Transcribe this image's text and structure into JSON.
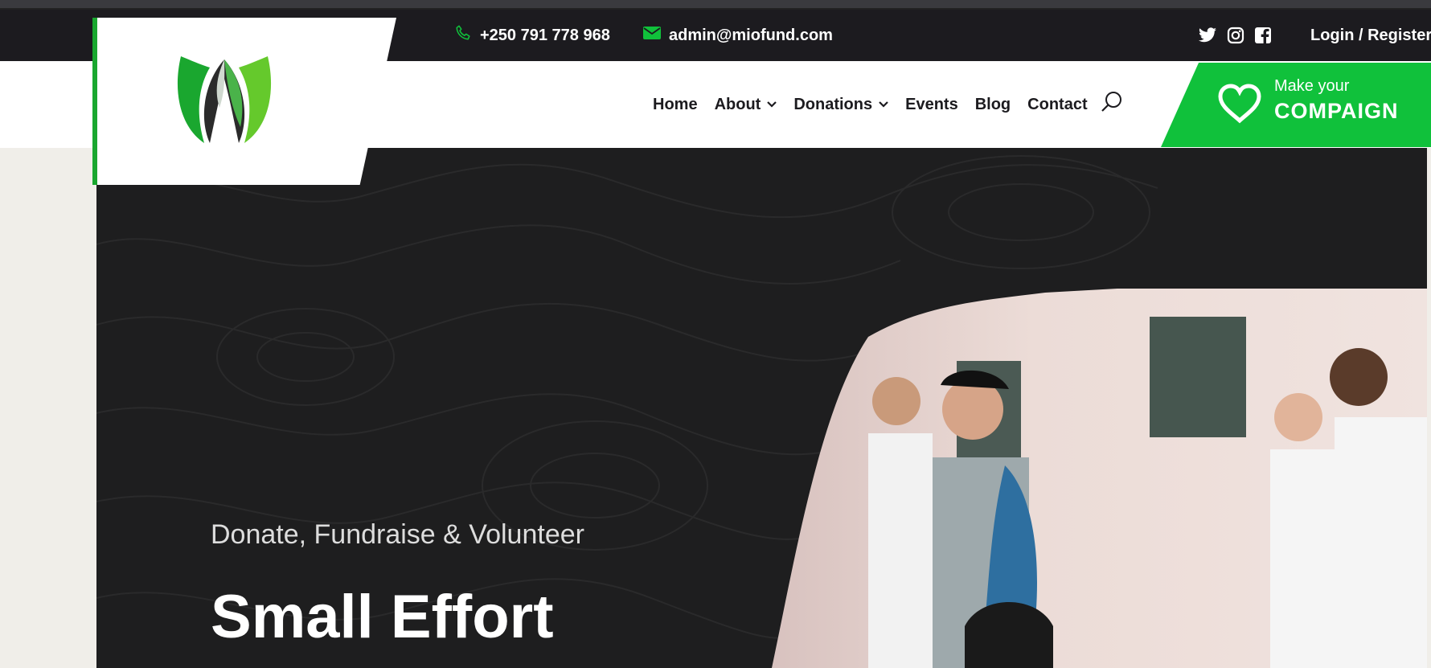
{
  "topbar": {
    "phone": "+250 791 778 968",
    "email": "admin@miofund.com",
    "social": [
      "twitter-icon",
      "instagram-icon",
      "facebook-icon"
    ],
    "login_label": "Login / Register"
  },
  "nav": {
    "items": [
      {
        "label": "Home"
      },
      {
        "label": "About"
      },
      {
        "label": "Donations"
      },
      {
        "label": "Events"
      },
      {
        "label": "Blog"
      },
      {
        "label": "Contact"
      }
    ]
  },
  "cta": {
    "line1": "Make your",
    "line2": "COMPAIGN"
  },
  "hero": {
    "subtitle": "Donate, Fundraise & Volunteer",
    "headline": "Small Effort"
  },
  "colors": {
    "accent": "#10c13b",
    "dark": "#1c1b1f",
    "hero_bg": "#1e1e1f"
  }
}
